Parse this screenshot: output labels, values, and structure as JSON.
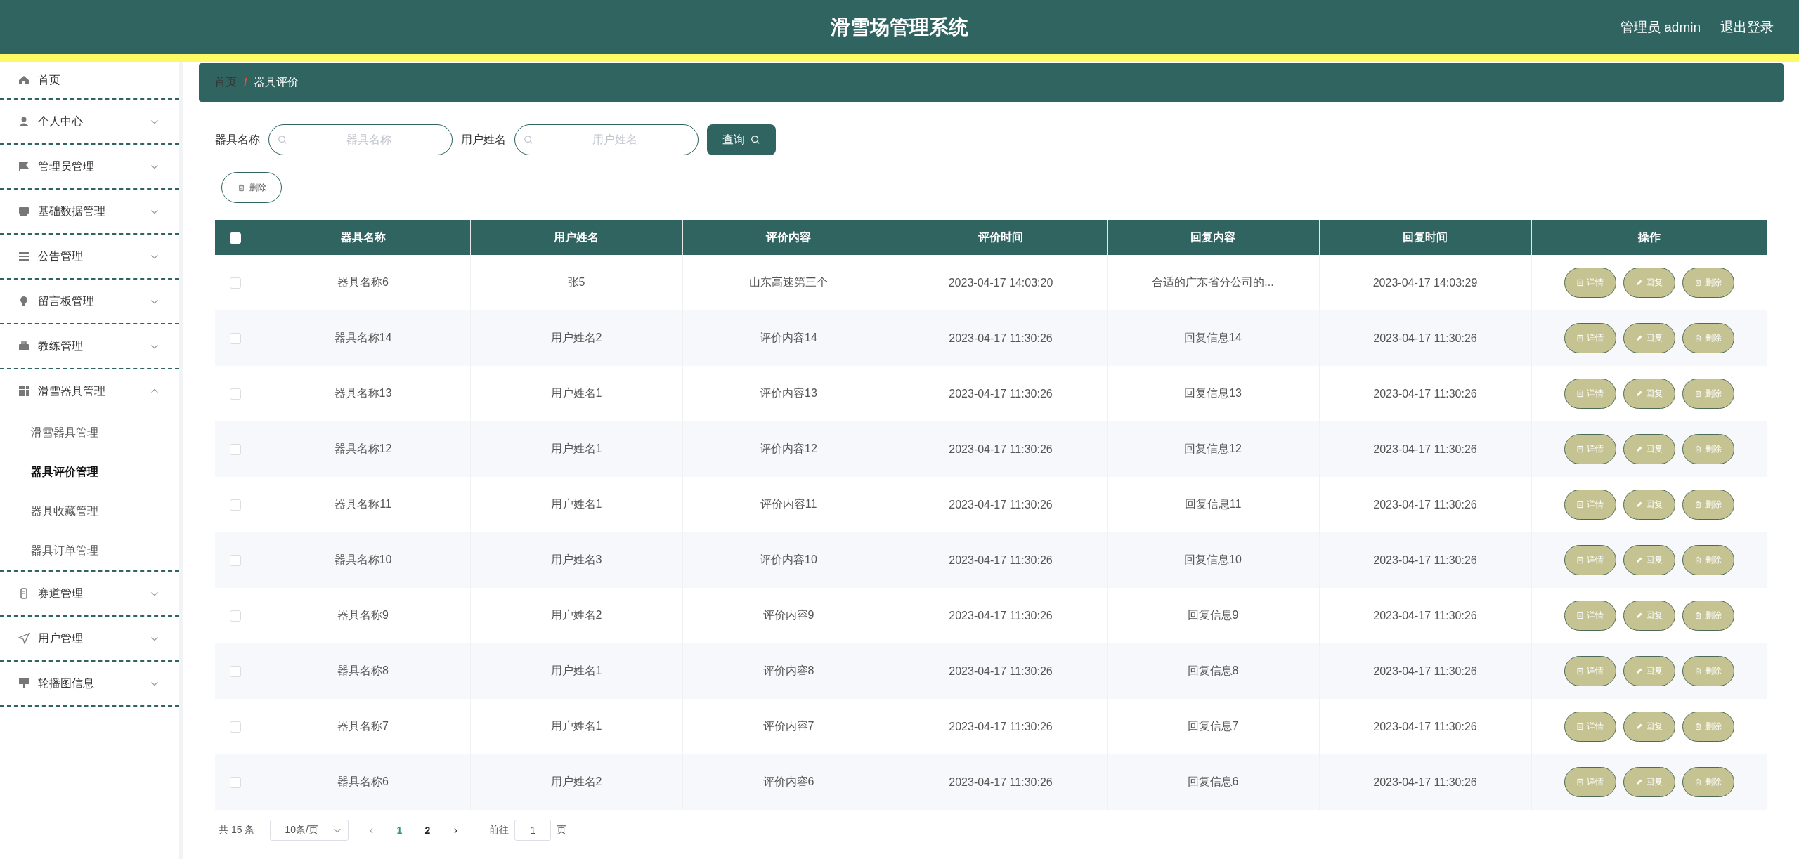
{
  "header": {
    "title": "滑雪场管理系统",
    "user": "管理员 admin",
    "logout": "退出登录"
  },
  "sidebar": {
    "items": [
      {
        "label": "首页"
      },
      {
        "label": "个人中心",
        "expanded": false
      },
      {
        "label": "管理员管理",
        "expanded": false
      },
      {
        "label": "基础数据管理",
        "expanded": false
      },
      {
        "label": "公告管理",
        "expanded": false
      },
      {
        "label": "留言板管理",
        "expanded": false
      },
      {
        "label": "教练管理",
        "expanded": false
      },
      {
        "label": "滑雪器具管理",
        "expanded": true,
        "children": [
          {
            "label": "滑雪器具管理",
            "selected": false
          },
          {
            "label": "器具评价管理",
            "selected": true
          },
          {
            "label": "器具收藏管理",
            "selected": false
          },
          {
            "label": "器具订单管理",
            "selected": false
          }
        ]
      },
      {
        "label": "赛道管理",
        "expanded": false
      },
      {
        "label": "用户管理",
        "expanded": false
      },
      {
        "label": "轮播图信息",
        "expanded": false
      }
    ]
  },
  "breadcrumb": [
    "首页",
    "/",
    "器具评价"
  ],
  "search": [
    {
      "label": "器具名称",
      "placeholder": "器具名称"
    },
    {
      "label": "用户姓名",
      "placeholder": "用户姓名"
    }
  ],
  "search_button": "查询",
  "delete_button": "删除",
  "table": {
    "select_all": {
      "checked": false
    },
    "columns": [
      "器具名称",
      "用户姓名",
      "评价内容",
      "评价时间",
      "回复内容",
      "回复时间",
      "操作"
    ],
    "rows": [
      {
        "checked": false,
        "cells": [
          "器具名称6",
          "张5",
          "山东高速第三个",
          "2023-04-17 14:03:20",
          "合适的广东省分公司的...",
          "2023-04-17 14:03:29"
        ],
        "actions": [
          "详情",
          "回复",
          "删除"
        ]
      },
      {
        "checked": false,
        "cells": [
          "器具名称14",
          "用户姓名2",
          "评价内容14",
          "2023-04-17 11:30:26",
          "回复信息14",
          "2023-04-17 11:30:26"
        ],
        "actions": [
          "详情",
          "回复",
          "删除"
        ]
      },
      {
        "checked": false,
        "cells": [
          "器具名称13",
          "用户姓名1",
          "评价内容13",
          "2023-04-17 11:30:26",
          "回复信息13",
          "2023-04-17 11:30:26"
        ],
        "actions": [
          "详情",
          "回复",
          "删除"
        ]
      },
      {
        "checked": false,
        "cells": [
          "器具名称12",
          "用户姓名1",
          "评价内容12",
          "2023-04-17 11:30:26",
          "回复信息12",
          "2023-04-17 11:30:26"
        ],
        "actions": [
          "详情",
          "回复",
          "删除"
        ]
      },
      {
        "checked": false,
        "cells": [
          "器具名称11",
          "用户姓名1",
          "评价内容11",
          "2023-04-17 11:30:26",
          "回复信息11",
          "2023-04-17 11:30:26"
        ],
        "actions": [
          "详情",
          "回复",
          "删除"
        ]
      },
      {
        "checked": false,
        "cells": [
          "器具名称10",
          "用户姓名3",
          "评价内容10",
          "2023-04-17 11:30:26",
          "回复信息10",
          "2023-04-17 11:30:26"
        ],
        "actions": [
          "详情",
          "回复",
          "删除"
        ]
      },
      {
        "checked": false,
        "cells": [
          "器具名称9",
          "用户姓名2",
          "评价内容9",
          "2023-04-17 11:30:26",
          "回复信息9",
          "2023-04-17 11:30:26"
        ],
        "actions": [
          "详情",
          "回复",
          "删除"
        ]
      },
      {
        "checked": false,
        "cells": [
          "器具名称8",
          "用户姓名1",
          "评价内容8",
          "2023-04-17 11:30:26",
          "回复信息8",
          "2023-04-17 11:30:26"
        ],
        "actions": [
          "详情",
          "回复",
          "删除"
        ]
      },
      {
        "checked": false,
        "cells": [
          "器具名称7",
          "用户姓名1",
          "评价内容7",
          "2023-04-17 11:30:26",
          "回复信息7",
          "2023-04-17 11:30:26"
        ],
        "actions": [
          "详情",
          "回复",
          "删除"
        ]
      },
      {
        "checked": false,
        "cells": [
          "器具名称6",
          "用户姓名2",
          "评价内容6",
          "2023-04-17 11:30:26",
          "回复信息6",
          "2023-04-17 11:30:26"
        ],
        "actions": [
          "详情",
          "回复",
          "删除"
        ]
      }
    ]
  },
  "pagination": {
    "total": "共 15 条",
    "page_size": "10条/页",
    "prev": "‹",
    "pages": [
      {
        "label": "1",
        "selected": true
      },
      {
        "label": "2",
        "selected": false
      }
    ],
    "next": "›",
    "goto_label": "前往",
    "goto_value": "1",
    "goto_suffix": "页"
  }
}
